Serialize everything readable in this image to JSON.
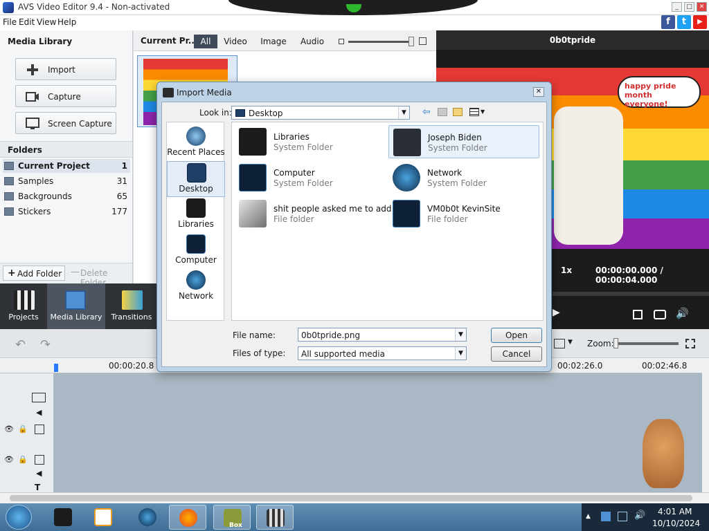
{
  "window": {
    "title": "AVS Video Editor 9.4 - Non-activated",
    "min": "_",
    "max": "□",
    "close": "✕"
  },
  "social": {
    "facebook": "f",
    "twitter": "t",
    "youtube": "▶"
  },
  "menu": [
    "File",
    "Edit",
    "View",
    "Help"
  ],
  "left_panel": {
    "header": "Media Library",
    "import": "Import",
    "capture": "Capture",
    "screen_capture": "Screen Capture",
    "folders_header": "Folders",
    "folders": [
      {
        "name": "Current Project",
        "count": "1"
      },
      {
        "name": "Samples",
        "count": "31"
      },
      {
        "name": "Backgrounds",
        "count": "65"
      },
      {
        "name": "Stickers",
        "count": "177"
      }
    ],
    "add_folder": "Add Folder",
    "delete_folder": "Delete Folder"
  },
  "media_toolbar": {
    "current": "Current Pr...",
    "tabs": [
      "All",
      "Video",
      "Image",
      "Audio"
    ]
  },
  "preview": {
    "title": "0b0tpride",
    "speech": "happy pride month everyone!",
    "speed": "1x",
    "time": "00:00:00.000 / 00:00:04.000"
  },
  "bottom_nav": [
    "Projects",
    "Media Library",
    "Transitions"
  ],
  "timeline": {
    "zoom_label": "Zoom:",
    "ruler": [
      "00:00:20.8",
      "00:02:26.0",
      "00:02:46.8"
    ]
  },
  "dialog": {
    "title": "Import Media",
    "look_in_label": "Look in:",
    "look_in_value": "Desktop",
    "places": [
      "Recent Places",
      "Desktop",
      "Libraries",
      "Computer",
      "Network"
    ],
    "items": [
      {
        "name": "Libraries",
        "type": "System Folder"
      },
      {
        "name": "Joseph Biden",
        "type": "System Folder"
      },
      {
        "name": "Computer",
        "type": "System Folder"
      },
      {
        "name": "Network",
        "type": "System Folder"
      },
      {
        "name": "shit people asked me to add",
        "type": "File folder"
      },
      {
        "name": "VM0b0t KevinSite",
        "type": "File folder"
      }
    ],
    "file_name_label": "File name:",
    "file_name_value": "0b0tpride.png",
    "files_of_type_label": "Files of type:",
    "files_of_type_value": "All supported media",
    "open": "Open",
    "cancel": "Cancel"
  },
  "taskbar": {
    "clock_time": "4:01 AM",
    "clock_date": "10/10/2024",
    "box_label": "Box"
  }
}
